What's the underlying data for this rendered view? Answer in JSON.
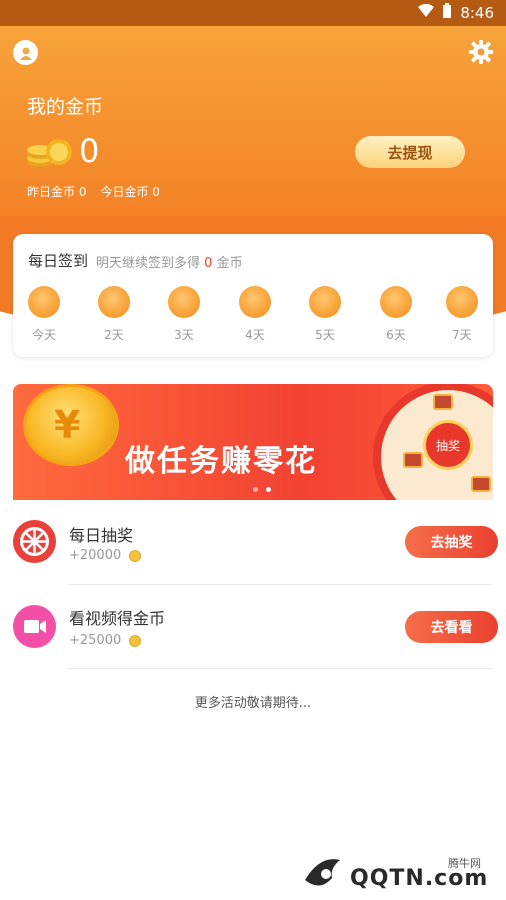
{
  "status_bar": {
    "time": "8:46"
  },
  "header": {
    "my_coins_label": "我的金币",
    "coin_balance": "0",
    "withdraw_button": "去提现",
    "yesterday_coins": "昨日金币 0",
    "today_coins": "今日金币 0"
  },
  "signin": {
    "title": "每日签到",
    "subtitle_prefix": "明天继续签到多得",
    "subtitle_value": "0",
    "subtitle_suffix": "金币",
    "days": [
      "今天",
      "2天",
      "3天",
      "4天",
      "5天",
      "6天",
      "7天"
    ]
  },
  "banner": {
    "text": "做任务赚零花",
    "wheel_label": "抽奖"
  },
  "tasks": [
    {
      "title": "每日抽奖",
      "reward": "+20000",
      "button": "去抽奖",
      "icon": "lottery-wheel-icon",
      "icon_color": "#e9403a"
    },
    {
      "title": "看视频得金币",
      "reward": "+25000",
      "button": "去看看",
      "icon": "video-camera-icon",
      "icon_color": "#f150a6"
    }
  ],
  "footer_text": "更多活动敬请期待...",
  "watermark": {
    "site_label": "腾牛网",
    "logo": "QQTN.com"
  },
  "colors": {
    "header_orange": "#f48a2a",
    "button_red": "#e9402f",
    "accent_red": "#e8432e"
  }
}
